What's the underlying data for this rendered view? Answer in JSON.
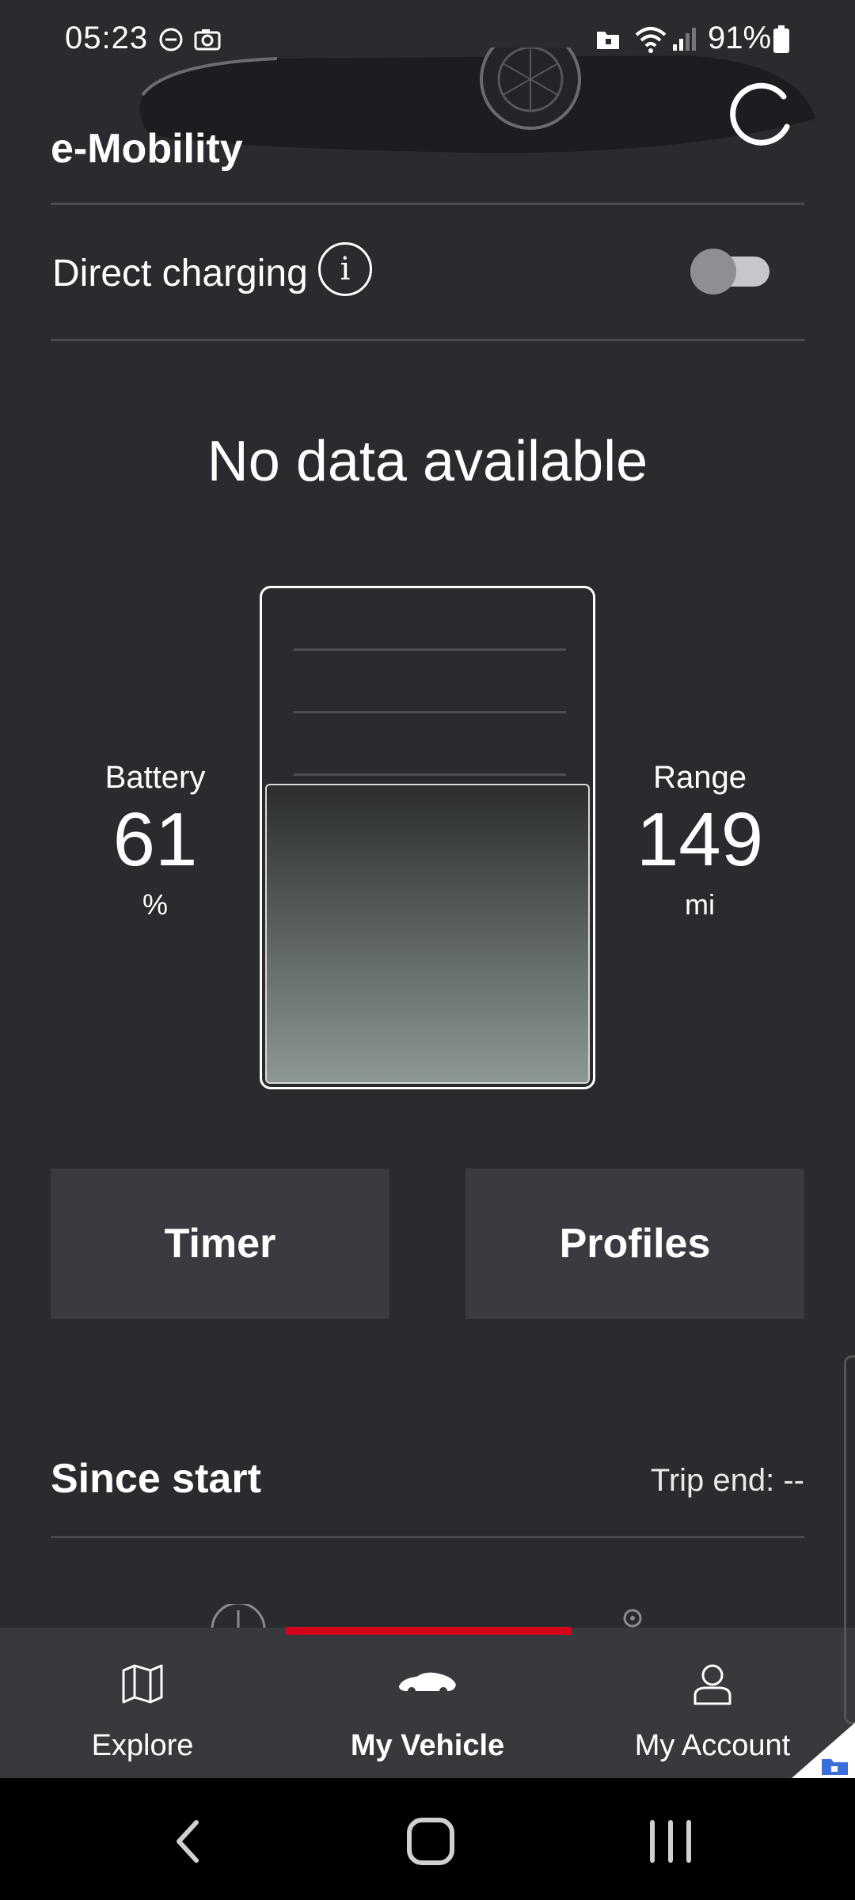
{
  "status_bar": {
    "time": "05:23",
    "battery_percent": "91%"
  },
  "header": {
    "title": "e-Mobility"
  },
  "direct_charging": {
    "label": "Direct charging",
    "info_glyph": "i",
    "enabled": false
  },
  "message": "No data available",
  "battery": {
    "label": "Battery",
    "value": "61",
    "unit": "%",
    "fill_fraction": 0.61
  },
  "range": {
    "label": "Range",
    "value": "149",
    "unit": "mi"
  },
  "tiles": {
    "timer": "Timer",
    "profiles": "Profiles"
  },
  "trip": {
    "title": "Since start",
    "end": "Trip end: --"
  },
  "bottom_nav": {
    "items": [
      {
        "label": "Explore",
        "icon": "map-icon",
        "active": false
      },
      {
        "label": "My Vehicle",
        "icon": "car-icon",
        "active": true
      },
      {
        "label": "My Account",
        "icon": "user-icon",
        "active": false
      }
    ]
  },
  "colors": {
    "background": "#2a2b2f",
    "tile": "#3a3b40",
    "accent_red": "#d5001c"
  }
}
